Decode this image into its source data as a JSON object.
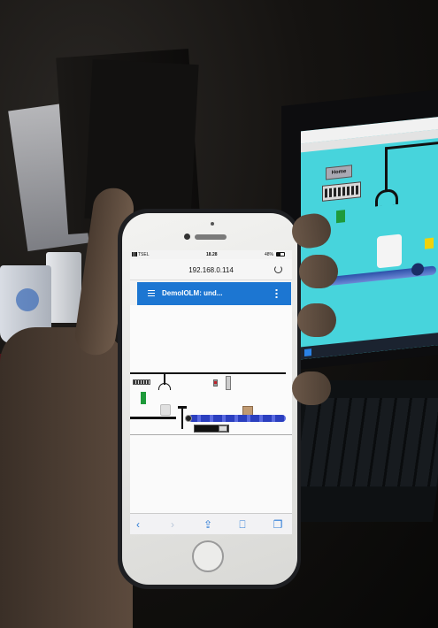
{
  "phone": {
    "status_bar": {
      "carrier": "TSEL",
      "time": "18.28",
      "battery": "48%"
    },
    "browser": {
      "url": "192.168.0.114"
    },
    "app_header": {
      "title": "DemoIOLM: und..."
    },
    "toolbar": {
      "back_icon": "back-arrow-icon",
      "forward_icon": "forward-arrow-icon",
      "share_icon": "share-icon",
      "bookmarks_icon": "book-icon",
      "tabs_icon": "tabs-icon"
    },
    "colors": {
      "app_header": "#1c76d2",
      "conveyor": "#2b3fbf"
    }
  },
  "laptop": {
    "home_button": "Home"
  }
}
